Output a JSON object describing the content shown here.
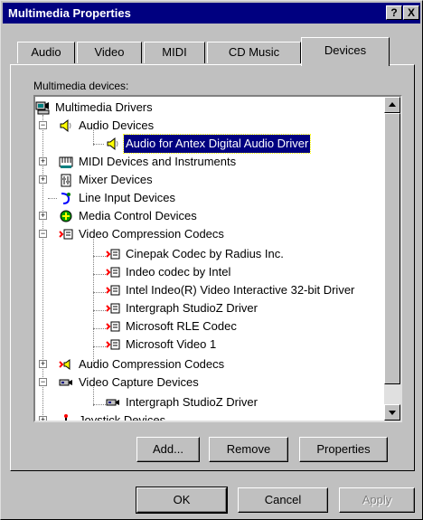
{
  "window": {
    "title": "Multimedia Properties",
    "help_glyph": "?",
    "close_glyph": "X"
  },
  "tabs": [
    {
      "label": "Audio",
      "active": false
    },
    {
      "label": "Video",
      "active": false
    },
    {
      "label": "MIDI",
      "active": false
    },
    {
      "label": "CD Music",
      "active": false
    },
    {
      "label": "Devices",
      "active": true
    }
  ],
  "devices_label": "Multimedia devices:",
  "tree": [
    {
      "label": "Multimedia Drivers",
      "icon": "computer-icon",
      "expand": "none"
    },
    {
      "label": "Audio Devices",
      "icon": "speaker-icon",
      "expand": "minus"
    },
    {
      "label": "Audio for Antex Digital Audio Driver",
      "icon": "speaker-icon",
      "selected": true
    },
    {
      "label": "MIDI Devices and Instruments",
      "icon": "midi-icon",
      "expand": "plus"
    },
    {
      "label": "Mixer Devices",
      "icon": "mixer-icon",
      "expand": "plus"
    },
    {
      "label": "Line Input Devices",
      "icon": "line-input-icon",
      "expand": "none"
    },
    {
      "label": "Media Control Devices",
      "icon": "media-control-icon",
      "expand": "plus"
    },
    {
      "label": "Video Compression Codecs",
      "icon": "codec-icon",
      "expand": "minus"
    },
    {
      "label": "Cinepak Codec by Radius Inc.",
      "icon": "codec-icon"
    },
    {
      "label": "Indeo codec by Intel",
      "icon": "codec-icon"
    },
    {
      "label": "Intel Indeo(R) Video Interactive 32-bit Driver",
      "icon": "codec-icon"
    },
    {
      "label": "Intergraph StudioZ Driver",
      "icon": "codec-icon"
    },
    {
      "label": "Microsoft RLE Codec",
      "icon": "codec-icon"
    },
    {
      "label": "Microsoft Video 1",
      "icon": "codec-icon"
    },
    {
      "label": "Audio Compression Codecs",
      "icon": "audio-codec-icon",
      "expand": "plus"
    },
    {
      "label": "Video Capture Devices",
      "icon": "video-capture-icon",
      "expand": "minus"
    },
    {
      "label": "Intergraph StudioZ Driver",
      "icon": "video-capture-icon"
    },
    {
      "label": "Joystick Devices",
      "icon": "joystick-icon",
      "expand": "plus"
    }
  ],
  "buttons": {
    "add": "Add...",
    "remove": "Remove",
    "properties": "Properties",
    "ok": "OK",
    "cancel": "Cancel",
    "apply": "Apply"
  },
  "colors": {
    "face": "#c0c0c0",
    "title_bg": "#000080",
    "selection": "#000080"
  }
}
